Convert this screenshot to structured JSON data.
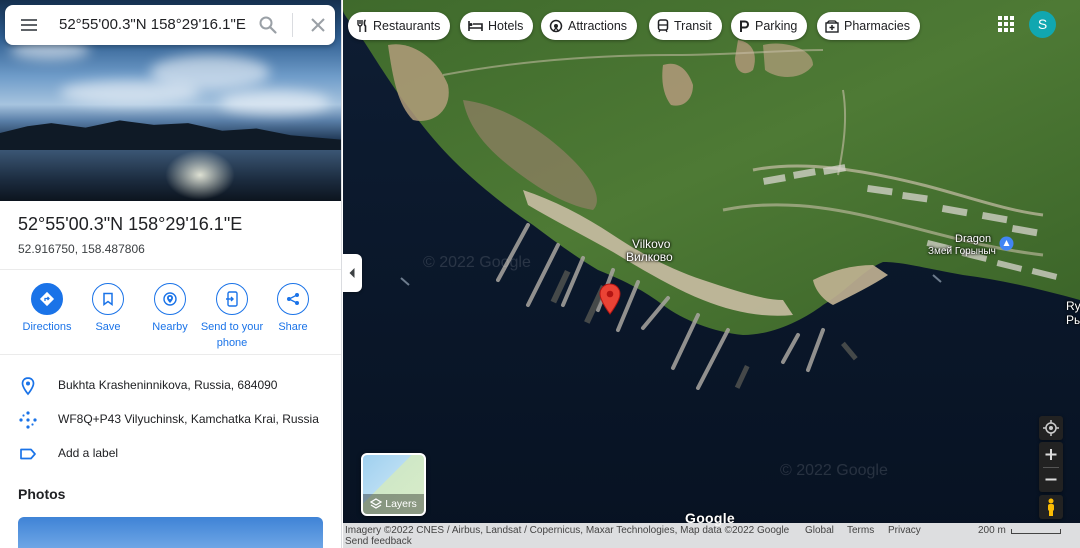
{
  "search": {
    "query": "52°55'00.3\"N 158°29'16.1\"E"
  },
  "place": {
    "title": "52°55'00.3\"N 158°29'16.1\"E",
    "decimal": "52.916750, 158.487806",
    "address": "Bukhta Krasheninnikova, Russia, 684090",
    "plus_code": "WF8Q+P43 Vilyuchinsk, Kamchatka Krai, Russia",
    "add_label": "Add a label"
  },
  "actions": [
    {
      "label": "Directions",
      "icon": "directions-icon"
    },
    {
      "label": "Save",
      "icon": "bookmark-icon"
    },
    {
      "label": "Nearby",
      "icon": "nearby-icon"
    },
    {
      "label": "Send to your phone",
      "icon": "send-to-phone-icon"
    },
    {
      "label": "Share",
      "icon": "share-icon"
    }
  ],
  "photos": {
    "heading": "Photos"
  },
  "chips": [
    {
      "label": "Restaurants",
      "icon": "restaurant-icon"
    },
    {
      "label": "Hotels",
      "icon": "hotel-icon"
    },
    {
      "label": "Attractions",
      "icon": "attractions-icon"
    },
    {
      "label": "Transit",
      "icon": "transit-icon"
    },
    {
      "label": "Parking",
      "icon": "parking-icon"
    },
    {
      "label": "Pharmacies",
      "icon": "pharmacy-icon"
    }
  ],
  "user": {
    "avatar_letter": "S"
  },
  "map_labels": {
    "vilkovo_latin": "Vilkovo",
    "vilkovo_cyrillic": "Вилково",
    "dragon": "Dragon",
    "dragon_cyrillic": "Змей Горыныч",
    "edge_top": "Ry",
    "edge_bottom": "Ры",
    "watermark": "© 2022 Google"
  },
  "layers": {
    "label": "Layers"
  },
  "google_wordmark": "Google",
  "footer": {
    "attribution": "Imagery ©2022 CNES / Airbus, Landsat / Copernicus, Maxar Technologies, Map data ©2022 Google",
    "global": "Global",
    "terms": "Terms",
    "privacy": "Privacy",
    "scale": "200 m",
    "send_feedback": "Send feedback"
  },
  "colors": {
    "accent": "#1a73e8",
    "pin": "#ea4335",
    "avatar": "#11a7b0"
  }
}
